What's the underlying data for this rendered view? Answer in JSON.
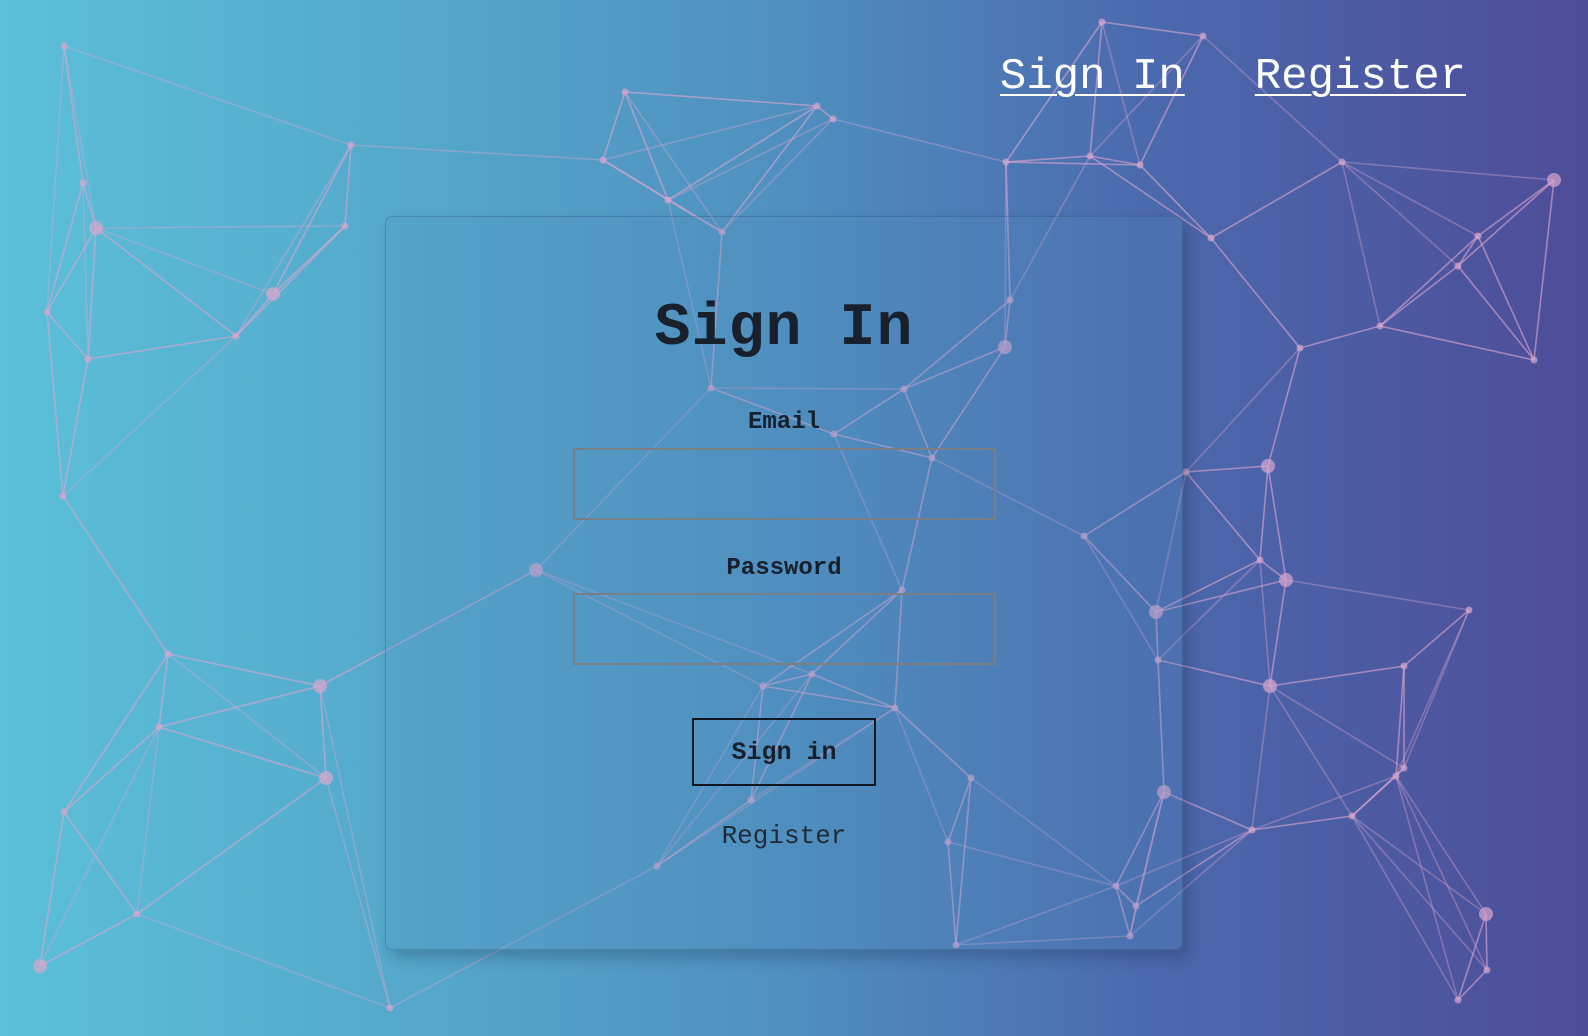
{
  "nav": {
    "sign_in": "Sign In",
    "register": "Register"
  },
  "form": {
    "title": "Sign In",
    "email_label": "Email",
    "email_value": "",
    "password_label": "Password",
    "password_value": "",
    "submit_label": "Sign in",
    "register_link": "Register"
  },
  "colors": {
    "gradient_start": "#5bc0d9",
    "gradient_end": "#4e4c98",
    "network_lines": "#d9a6cf",
    "text": "#17202c"
  }
}
